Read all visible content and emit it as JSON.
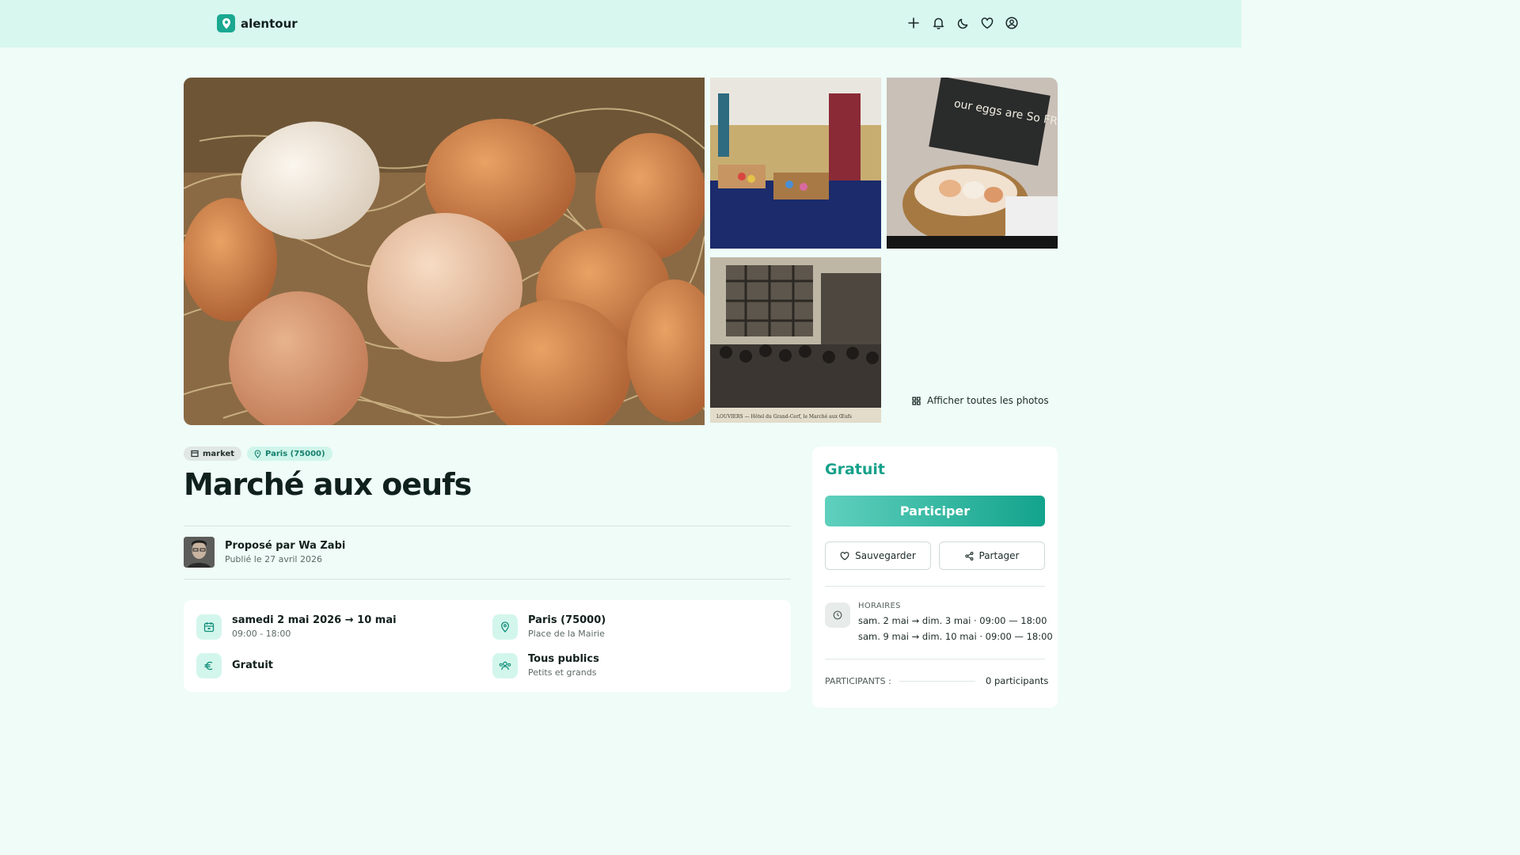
{
  "header": {
    "app_name": "alentour",
    "icons": [
      "add-icon",
      "bell-icon",
      "moon-icon",
      "heart-icon",
      "user-circle-icon"
    ]
  },
  "gallery": {
    "show_all_label": "Afficher toutes les photos",
    "thumb2_text": "our eggs are So FRESH they Keep for more",
    "thumb3_caption": "LOUVIERS — Hôtel du Grand-Cerf, le Marché aux Œufs"
  },
  "event": {
    "tags": {
      "category": "market",
      "location": "Paris (75000)"
    },
    "title": "Marché aux oeufs",
    "organizer": {
      "label": "Proposé par Wa Zabi",
      "published": "Publié le 27 avril 2026"
    },
    "info": {
      "date_main": "samedi 2 mai 2026 → 10 mai",
      "date_sub": "09:00 - 18:00",
      "place_main": "Paris (75000)",
      "place_sub": "Place de la Mairie",
      "price_main": "Gratuit",
      "audience_main": "Tous publics",
      "audience_sub": "Petits et grands"
    }
  },
  "sidebar": {
    "price": "Gratuit",
    "participate_label": "Participer",
    "save_label": "Sauvegarder",
    "share_label": "Partager",
    "schedule_label": "HORAIRES",
    "schedule": [
      "sam. 2 mai → dim. 3 mai · 09:00 — 18:00",
      "sam. 9 mai → dim. 10 mai · 09:00 — 18:00"
    ],
    "participants_label": "PARTICIPANTS :",
    "participants_value": "0 participants"
  },
  "colors": {
    "accent": "#17a18b",
    "header_bg": "#d7f7ef",
    "page_bg": "#effcf8"
  }
}
